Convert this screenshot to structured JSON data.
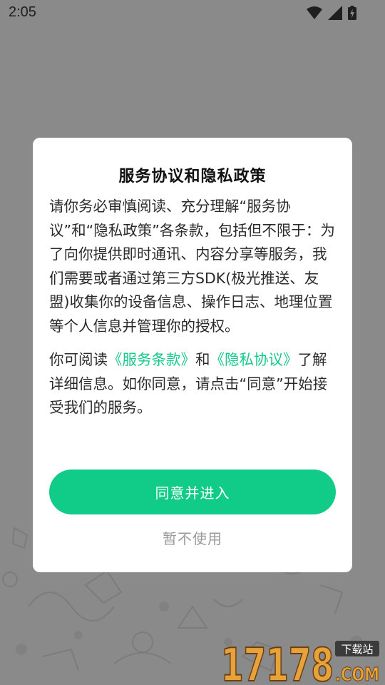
{
  "status_bar": {
    "time": "2:05",
    "icons": [
      "wifi-icon",
      "cell-signal-icon",
      "battery-charging-icon"
    ]
  },
  "dialog": {
    "title": "服务协议和隐私政策",
    "paragraph1": "请你务必审慎阅读、充分理解“服务协议”和“隐私政策”各条款，包括但不限于：为了向你提供即时通讯、内容分享等服务，我们需要或者通过第三方SDK(极光推送、友盟)收集你的设备信息、操作日志、地理位置等个人信息并管理你的授权。",
    "paragraph2": {
      "prefix": "你可阅读",
      "terms_link": "《服务条款》",
      "conjunction": "和",
      "privacy_link": "《隐私协议》",
      "suffix": "了解详细信息。如你同意，请点击“同意”开始接受我们的服务。"
    },
    "agree_label": "同意并进入",
    "decline_label": "暂不使用"
  },
  "watermark": {
    "number": "17178",
    "tag": "下载站",
    "domain": ".COM"
  },
  "colors": {
    "accent": "#11cc88",
    "link": "#16c98a",
    "overlay": "#8a8a8a"
  }
}
